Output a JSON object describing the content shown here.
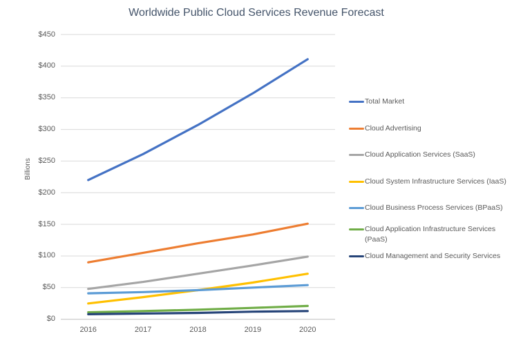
{
  "chart_data": {
    "type": "line",
    "title": "Worldwide Public Cloud Services Revenue Forecast",
    "ylabel": "Billions",
    "xlabel": "",
    "x_labels": [
      "2016",
      "2017",
      "2018",
      "2019",
      "2020"
    ],
    "ytick_labels": [
      "$0",
      "$50",
      "$100",
      "$150",
      "$200",
      "$250",
      "$300",
      "$350",
      "$400",
      "$450"
    ],
    "ylim": [
      0,
      450
    ],
    "ytick_step": 50,
    "grid": "horizontal",
    "legend_position": "right",
    "series": [
      {
        "name": "Total Market",
        "color": "#4472C4",
        "values": [
          220,
          261,
          307,
          357,
          411
        ]
      },
      {
        "name": "Cloud Advertising",
        "color": "#ED7D31",
        "values": [
          90,
          105,
          120,
          134,
          151
        ]
      },
      {
        "name": "Cloud Application Services (SaaS)",
        "color": "#A5A5A5",
        "values": [
          48,
          59,
          72,
          85,
          99
        ]
      },
      {
        "name": "Cloud System Infrastructure Services (IaaS)",
        "color": "#FFC000",
        "values": [
          25,
          35,
          46,
          58,
          72
        ]
      },
      {
        "name": "Cloud Business Process Services (BPaaS)",
        "color": "#5B9BD5",
        "values": [
          41,
          43,
          46,
          50,
          54
        ]
      },
      {
        "name": "Cloud Application Infrastructure Services (PaaS)",
        "color": "#70AD47",
        "values": [
          11,
          13,
          15,
          18,
          21
        ]
      },
      {
        "name": "Cloud Management and Security Services",
        "color": "#264478",
        "values": [
          8,
          9,
          10,
          12,
          13
        ]
      }
    ],
    "colors": {
      "gridline": "#D9D9D9",
      "axis_line": "#BFBFBF",
      "tick_text": "#595959",
      "title_text": "#44546A",
      "background": "#FFFFFF"
    }
  }
}
